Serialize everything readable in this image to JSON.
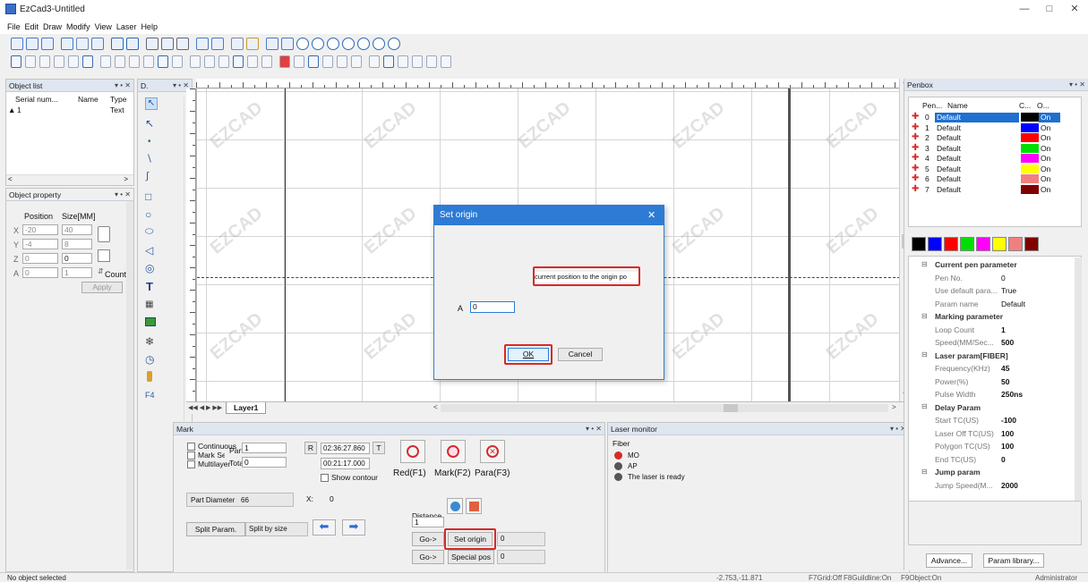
{
  "window": {
    "title": "EzCad3-Untitled"
  },
  "menu": [
    "File",
    "Edit",
    "Draw",
    "Modify",
    "View",
    "Laser",
    "Help"
  ],
  "object_list": {
    "header": "Object list",
    "columns": [
      "Serial num...",
      "Name",
      "Type"
    ],
    "rows": [
      {
        "serial": "1",
        "name": "",
        "type": "Text"
      }
    ]
  },
  "drawing_panel": {
    "header": "D."
  },
  "object_property": {
    "header": "Object property",
    "position_label": "Position",
    "size_label": "Size[MM]",
    "x_label": "X",
    "x_pos": "-20",
    "x_size": "40",
    "y_label": "Y",
    "y_pos": "-4",
    "y_size": "8",
    "z_label": "Z",
    "z_pos": "0",
    "z_size": "0",
    "a_label": "A",
    "a_pos": "0",
    "a_size": "1",
    "count_label": "Count",
    "apply_label": "Apply"
  },
  "canvas": {
    "watermark": "EZCAD",
    "layer_tab": "Layer1"
  },
  "dialog": {
    "title": "Set origin",
    "message": "current position to the origin po",
    "a_label": "A",
    "a_value": "0",
    "ok_label": "OK",
    "cancel_label": "Cancel"
  },
  "mark": {
    "header": "Mark",
    "continuous": "Continuous",
    "mark_select": "Mark Select",
    "multilayer": "Multilayer",
    "part_label": "Part",
    "part_value": "1",
    "total_label": "Total",
    "total_value": "0",
    "r_label": "R",
    "t_label": "T",
    "time1": "02:36:27.860",
    "time2": "00:21:17.000",
    "show_contour": "Show contour",
    "red_label": "Red(F1)",
    "mark_label": "Mark(F2)",
    "para_label": "Para(F3)",
    "part_diameter_label": "Part Diameter",
    "part_diameter_value": "66",
    "x_label": "X:",
    "x_value": "0",
    "distance_label": "Distance",
    "distance_value": "1",
    "split_param": "Split Param.",
    "split_by": "Split by size",
    "go_label": "Go->",
    "set_origin": "Set origin",
    "set_origin_value": "0",
    "special_pos": "Special pos",
    "special_pos_value": "0"
  },
  "laser_monitor": {
    "header": "Laser monitor",
    "fiber": "Fiber",
    "items": [
      {
        "label": "MO",
        "color": "#d62b2b"
      },
      {
        "label": "AP",
        "color": "#555555"
      },
      {
        "label": "The laser is ready",
        "color": "#555555"
      }
    ]
  },
  "penbox": {
    "header": "Penbox",
    "columns": [
      "Pen...",
      "Name",
      "C...",
      "O..."
    ],
    "pens": [
      {
        "no": "0",
        "name": "Default",
        "color": "#000000",
        "on": "On"
      },
      {
        "no": "1",
        "name": "Default",
        "color": "#0000ff",
        "on": "On"
      },
      {
        "no": "2",
        "name": "Default",
        "color": "#ff0000",
        "on": "On"
      },
      {
        "no": "3",
        "name": "Default",
        "color": "#00dd00",
        "on": "On"
      },
      {
        "no": "4",
        "name": "Default",
        "color": "#ff00ff",
        "on": "On"
      },
      {
        "no": "5",
        "name": "Default",
        "color": "#ffff00",
        "on": "On"
      },
      {
        "no": "6",
        "name": "Default",
        "color": "#f08080",
        "on": "On"
      },
      {
        "no": "7",
        "name": "Default",
        "color": "#800000",
        "on": "On"
      }
    ],
    "palette": [
      "#000000",
      "#0000ff",
      "#ff0000",
      "#00dd00",
      "#ff00ff",
      "#ffff00",
      "#f08080",
      "#800000"
    ]
  },
  "pen_params": {
    "sections": [
      {
        "title": "Current pen parameter",
        "rows": [
          {
            "k": "Pen No.",
            "v": "0"
          },
          {
            "k": "Use default para...",
            "v": "True"
          },
          {
            "k": "Param name",
            "v": "Default"
          }
        ]
      },
      {
        "title": "Marking parameter",
        "rows": [
          {
            "k": "Loop Count",
            "v": "1"
          },
          {
            "k": "Speed(MM/Sec...",
            "v": "500"
          }
        ]
      },
      {
        "title": "Laser param[FIBER]",
        "rows": [
          {
            "k": "Frequency(KHz)",
            "v": "45"
          },
          {
            "k": "Power(%)",
            "v": "50"
          },
          {
            "k": "Pulse Width",
            "v": "250ns"
          }
        ]
      },
      {
        "title": "Delay Param",
        "rows": [
          {
            "k": "Start TC(US)",
            "v": "-100"
          },
          {
            "k": "Laser Off TC(US)",
            "v": "100"
          },
          {
            "k": "Polygon TC(US)",
            "v": "100"
          },
          {
            "k": "End TC(US)",
            "v": "0"
          }
        ]
      },
      {
        "title": "Jump param",
        "rows": [
          {
            "k": "Jump Speed(M...",
            "v": "2000"
          }
        ]
      }
    ],
    "advance": "Advance...",
    "library": "Param library..."
  },
  "status": {
    "left": "No object selected",
    "coords": "-2.753,-11.871",
    "grid": "F7Grid:Off",
    "guideline": "F8Guildline:On",
    "object": "F9Object:On",
    "user": "Administrator"
  }
}
